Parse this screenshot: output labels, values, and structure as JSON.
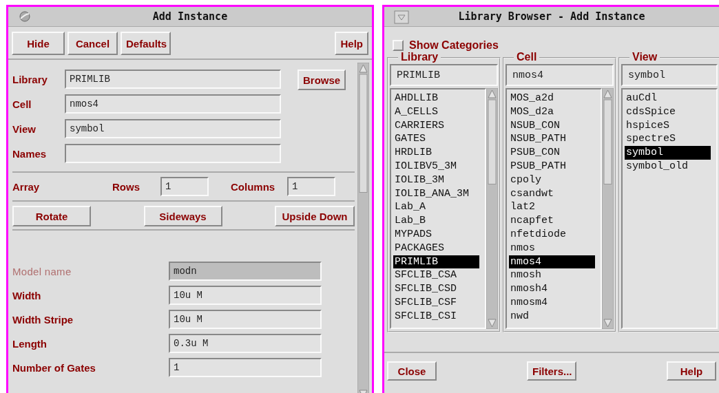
{
  "add_instance": {
    "title": "Add Instance",
    "buttons": [
      "Hide",
      "Cancel",
      "Defaults"
    ],
    "help_button": "Help",
    "fields": [
      {
        "label": "Library",
        "value": "PRIMLIB"
      },
      {
        "label": "Cell",
        "value": "nmos4"
      },
      {
        "label": "View",
        "value": "symbol"
      },
      {
        "label": "Names"
      }
    ],
    "browse_button": "Browse",
    "array": {
      "label": "Array",
      "rows_label": "Rows",
      "rows": "1",
      "columns_label": "Columns",
      "columns": "1"
    },
    "orient_buttons": [
      "Rotate",
      "Sideways",
      "Upside Down"
    ],
    "params": [
      {
        "label": "Model name",
        "value": "modn",
        "disabled": true
      },
      {
        "label": "Width",
        "value": "10u M",
        "disabled": false
      },
      {
        "label": "Width Stripe",
        "value": "10u M",
        "disabled": false
      },
      {
        "label": "Length",
        "value": "0.3u M",
        "disabled": false
      },
      {
        "label": "Number of Gates",
        "value": "1",
        "disabled": false
      }
    ]
  },
  "library_browser": {
    "title": "Library Browser - Add Instance",
    "show_categories": {
      "label": "Show Categories",
      "checked": false
    },
    "columns": [
      {
        "heading": "Library",
        "filter": "PRIMLIB",
        "scrollbar": true,
        "items": [
          {
            "label": "AHDLLIB",
            "selected": false
          },
          {
            "label": "A_CELLS",
            "selected": false
          },
          {
            "label": "CARRIERS",
            "selected": false
          },
          {
            "label": "GATES",
            "selected": false
          },
          {
            "label": "HRDLIB",
            "selected": false
          },
          {
            "label": "IOLIBV5_3M",
            "selected": false
          },
          {
            "label": "IOLIB_3M",
            "selected": false
          },
          {
            "label": "IOLIB_ANA_3M",
            "selected": false
          },
          {
            "label": "Lab_A",
            "selected": false
          },
          {
            "label": "Lab_B",
            "selected": false
          },
          {
            "label": "MYPADS",
            "selected": false
          },
          {
            "label": "PACKAGES",
            "selected": false
          },
          {
            "label": "PRIMLIB",
            "selected": true
          },
          {
            "label": "SFCLIB_CSA",
            "selected": false
          },
          {
            "label": "SFCLIB_CSD",
            "selected": false
          },
          {
            "label": "SFCLIB_CSF",
            "selected": false
          },
          {
            "label": "SFCLIB_CSI",
            "selected": false
          }
        ]
      },
      {
        "heading": "Cell",
        "filter": "nmos4",
        "scrollbar": true,
        "items": [
          {
            "label": "MOS_a2d",
            "selected": false
          },
          {
            "label": "MOS_d2a",
            "selected": false
          },
          {
            "label": "NSUB_CON",
            "selected": false
          },
          {
            "label": "NSUB_PATH",
            "selected": false
          },
          {
            "label": "PSUB_CON",
            "selected": false
          },
          {
            "label": "PSUB_PATH",
            "selected": false
          },
          {
            "label": "cpoly",
            "selected": false
          },
          {
            "label": "csandwt",
            "selected": false
          },
          {
            "label": "lat2",
            "selected": false
          },
          {
            "label": "ncapfet",
            "selected": false
          },
          {
            "label": "nfetdiode",
            "selected": false
          },
          {
            "label": "nmos",
            "selected": false
          },
          {
            "label": "nmos4",
            "selected": true
          },
          {
            "label": "nmosh",
            "selected": false
          },
          {
            "label": "nmosh4",
            "selected": false
          },
          {
            "label": "nmosm4",
            "selected": false
          },
          {
            "label": "nwd",
            "selected": false
          }
        ]
      },
      {
        "heading": "View",
        "filter": "symbol",
        "scrollbar": false,
        "items": [
          {
            "label": "auCdl",
            "selected": false
          },
          {
            "label": "cdsSpice",
            "selected": false
          },
          {
            "label": "hspiceS",
            "selected": false
          },
          {
            "label": "spectreS",
            "selected": false
          },
          {
            "label": "symbol",
            "selected": true
          },
          {
            "label": "symbol_old",
            "selected": false
          }
        ]
      }
    ],
    "buttons": [
      "Close",
      "Filters...",
      "Help"
    ]
  }
}
